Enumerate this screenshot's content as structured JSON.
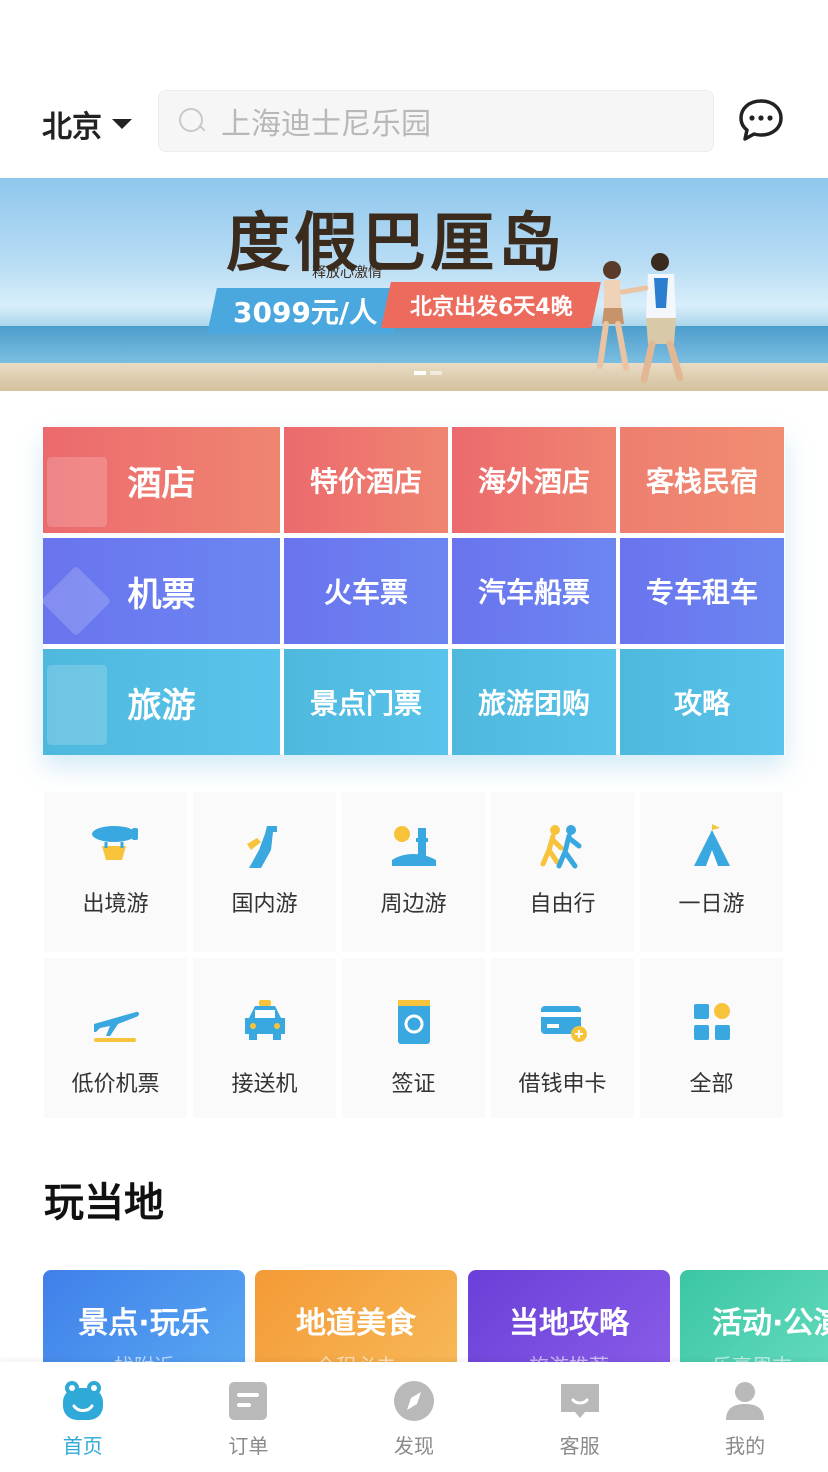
{
  "header": {
    "city": "北京",
    "search_placeholder": "上海迪士尼乐园"
  },
  "banner": {
    "title": "度假巴厘岛",
    "subtitle": "释放心激情",
    "price_tag": "3099元/人",
    "trip_tag": "北京出发6天4晚"
  },
  "categories": {
    "hotel": {
      "main": "酒店",
      "items": [
        "特价酒店",
        "海外酒店",
        "客栈民宿"
      ]
    },
    "flight": {
      "main": "机票",
      "items": [
        "火车票",
        "汽车船票",
        "专车租车"
      ]
    },
    "travel": {
      "main": "旅游",
      "items": [
        "景点门票",
        "旅游团购",
        "攻略"
      ]
    }
  },
  "services": {
    "row1": [
      "出境游",
      "国内游",
      "周边游",
      "自由行",
      "一日游"
    ],
    "row2": [
      "低价机票",
      "接送机",
      "签证",
      "借钱申卡",
      "全部"
    ]
  },
  "section": {
    "title": "玩当地"
  },
  "cards": [
    {
      "title": "景点·玩乐",
      "sub": "找附近"
    },
    {
      "title": "地道美食",
      "sub": "全程必去"
    },
    {
      "title": "当地攻略",
      "sub": "旅游推荐"
    },
    {
      "title": "活动·公演",
      "sub": "乐享周末"
    }
  ],
  "tabbar": [
    "首页",
    "订单",
    "发现",
    "客服",
    "我的"
  ],
  "colors": {
    "accent": "#2ea9d8",
    "hotel": "#ec6a6e",
    "flight": "#6a74ee",
    "travel": "#4fb8dd",
    "icon_blue": "#39a7e0",
    "icon_yellow": "#f7c33a"
  }
}
